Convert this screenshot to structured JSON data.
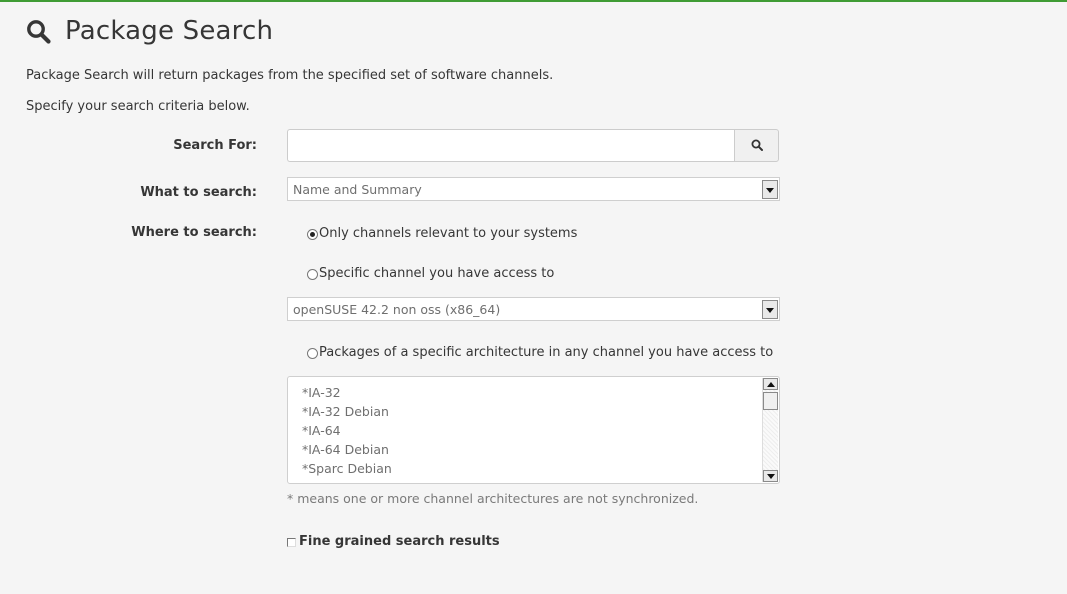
{
  "header": {
    "icon": "search-icon",
    "title": "Package Search"
  },
  "intro": {
    "line1": "Package Search will return packages from the specified set of software channels.",
    "line2": "Specify your search criteria below."
  },
  "form": {
    "search_for": {
      "label": "Search For:",
      "value": "",
      "placeholder": "",
      "button_icon": "search-icon"
    },
    "what_to_search": {
      "label": "What to search:",
      "selected": "Name and Summary"
    },
    "where_to_search": {
      "label": "Where to search:",
      "options": [
        {
          "label": "Only channels relevant to your systems",
          "checked": true
        },
        {
          "label": "Specific channel you have access to",
          "checked": false
        },
        {
          "label": "Packages of a specific architecture in any channel you have access to",
          "checked": false
        }
      ],
      "channel_selected": "openSUSE 42.2 non oss (x86_64)",
      "architectures": [
        "*IA-32",
        "*IA-32 Debian",
        "*IA-64",
        "*IA-64 Debian",
        "*Sparc Debian"
      ],
      "note": "* means one or more channel architectures are not synchronized."
    },
    "fine_grained": {
      "label": "Fine grained search results",
      "checked": false
    }
  },
  "colors": {
    "accent": "#3f9c35",
    "background": "#f5f5f5",
    "text": "#363636"
  }
}
